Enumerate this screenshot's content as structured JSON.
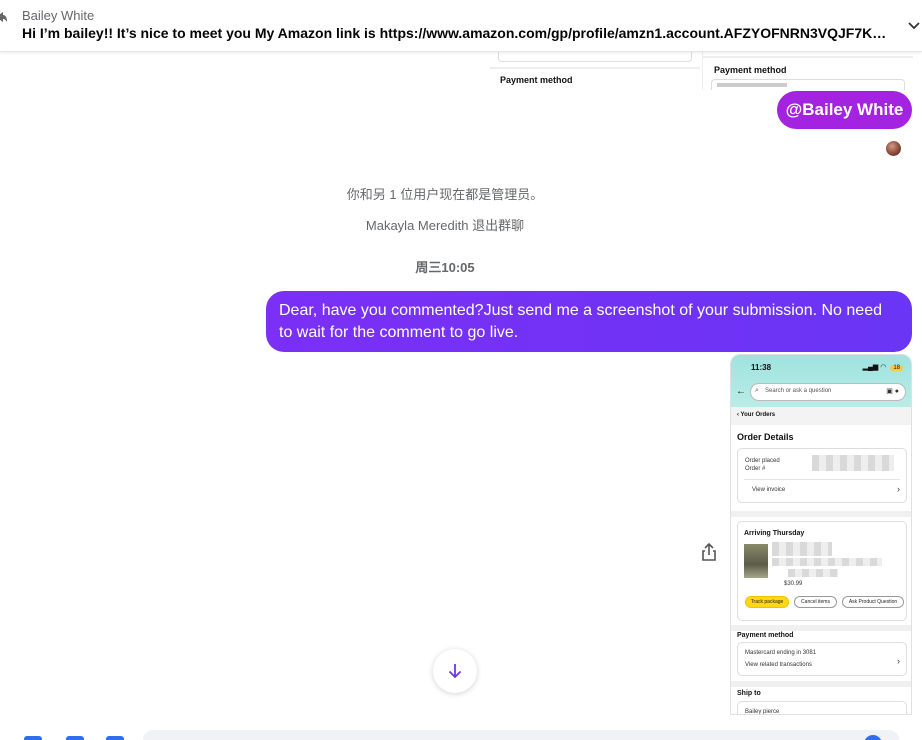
{
  "reply_preview": {
    "sender": "Bailey White",
    "text": "Hi I’m bailey!! It’s nice to meet you My Amazon link is https://www.amazon.com/gp/profile/amzn1.account.AFZYOFNRN3VQJF7KML..."
  },
  "prev_screenshot": {
    "label_left": "Payment method",
    "label_right": "Payment method"
  },
  "mention": {
    "text": "@Bailey White"
  },
  "system_messages": [
    "你和另 1 位用户现在都是管理员。",
    "Makayla Meredith 退出群聊"
  ],
  "timestamp": "周三10:05",
  "outgoing_message": "Dear, have you commented?Just send me a screenshot of your submission. No need to wait for the comment to go live.",
  "phone_screenshot": {
    "status_time": "11:38",
    "battery": "18",
    "search_placeholder": "Search or ask a question",
    "breadcrumb": "‹ Your Orders",
    "heading": "Order Details",
    "order_placed_label": "Order placed",
    "order_number_label": "Order #",
    "view_invoice": "View invoice",
    "arriving": "Arriving Thursday",
    "price": "$30.99",
    "buttons": [
      "Track package",
      "Cancel items",
      "Ask Product Question"
    ],
    "payment_heading": "Payment method",
    "payment_card": "Mastercard  ending in 3081",
    "view_transactions": "View related transactions",
    "ship_heading": "Ship to",
    "ship_name": "Bailey pierce"
  },
  "colors": {
    "mention_bubble": "#a323e0",
    "message_bubble": "#6a35f5",
    "accent_blue": "#2f6fed"
  },
  "icons": {
    "reply": "reply-arrow-icon",
    "collapse": "chevron-down-icon",
    "share": "share-icon",
    "scroll_down": "arrow-down-icon"
  }
}
